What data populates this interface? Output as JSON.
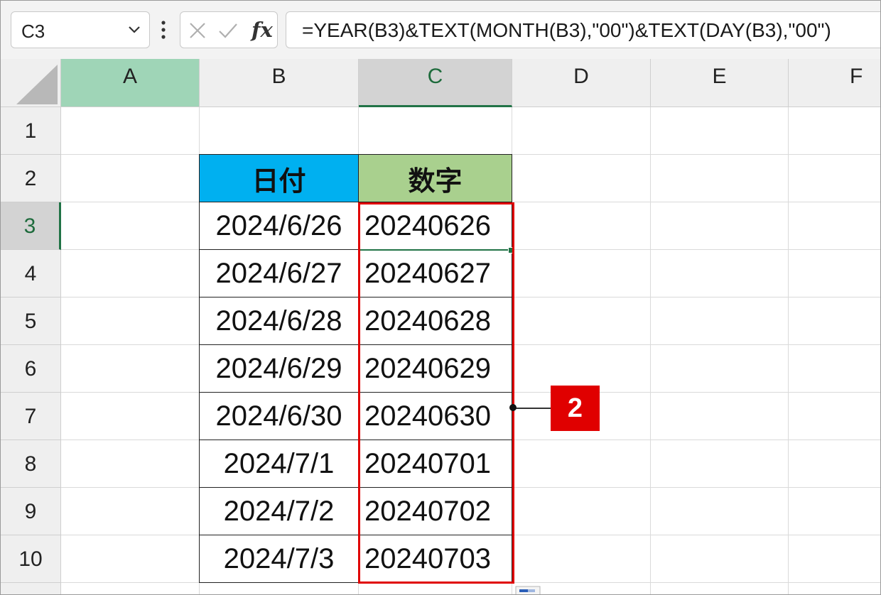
{
  "formula_bar": {
    "name_box": "C3",
    "formula": "=YEAR(B3)&TEXT(MONTH(B3),\"00\")&TEXT(DAY(B3),\"00\")",
    "icons": [
      "chevron-down-icon",
      "more-dots-icon",
      "cancel-icon",
      "enter-check-icon",
      "fx-icon"
    ]
  },
  "columns": [
    "A",
    "B",
    "C",
    "D",
    "E",
    "F"
  ],
  "rows": [
    "1",
    "2",
    "3",
    "4",
    "5",
    "6",
    "7",
    "8",
    "9",
    "10"
  ],
  "table": {
    "header_date": "日付",
    "header_number": "数字",
    "dates": [
      "2024/6/26",
      "2024/6/27",
      "2024/6/28",
      "2024/6/29",
      "2024/6/30",
      "2024/7/1",
      "2024/7/2",
      "2024/7/3"
    ],
    "numbers": [
      "20240626",
      "20240627",
      "20240628",
      "20240629",
      "20240630",
      "20240701",
      "20240702",
      "20240703"
    ]
  },
  "callout": {
    "label": "2"
  },
  "colors": {
    "header_date_fill": "#00b0f0",
    "header_number_fill": "#a9d08e",
    "selection_green": "#217346",
    "highlight_box": "#e00000",
    "column_a_highlight": "#9fd5b7"
  }
}
